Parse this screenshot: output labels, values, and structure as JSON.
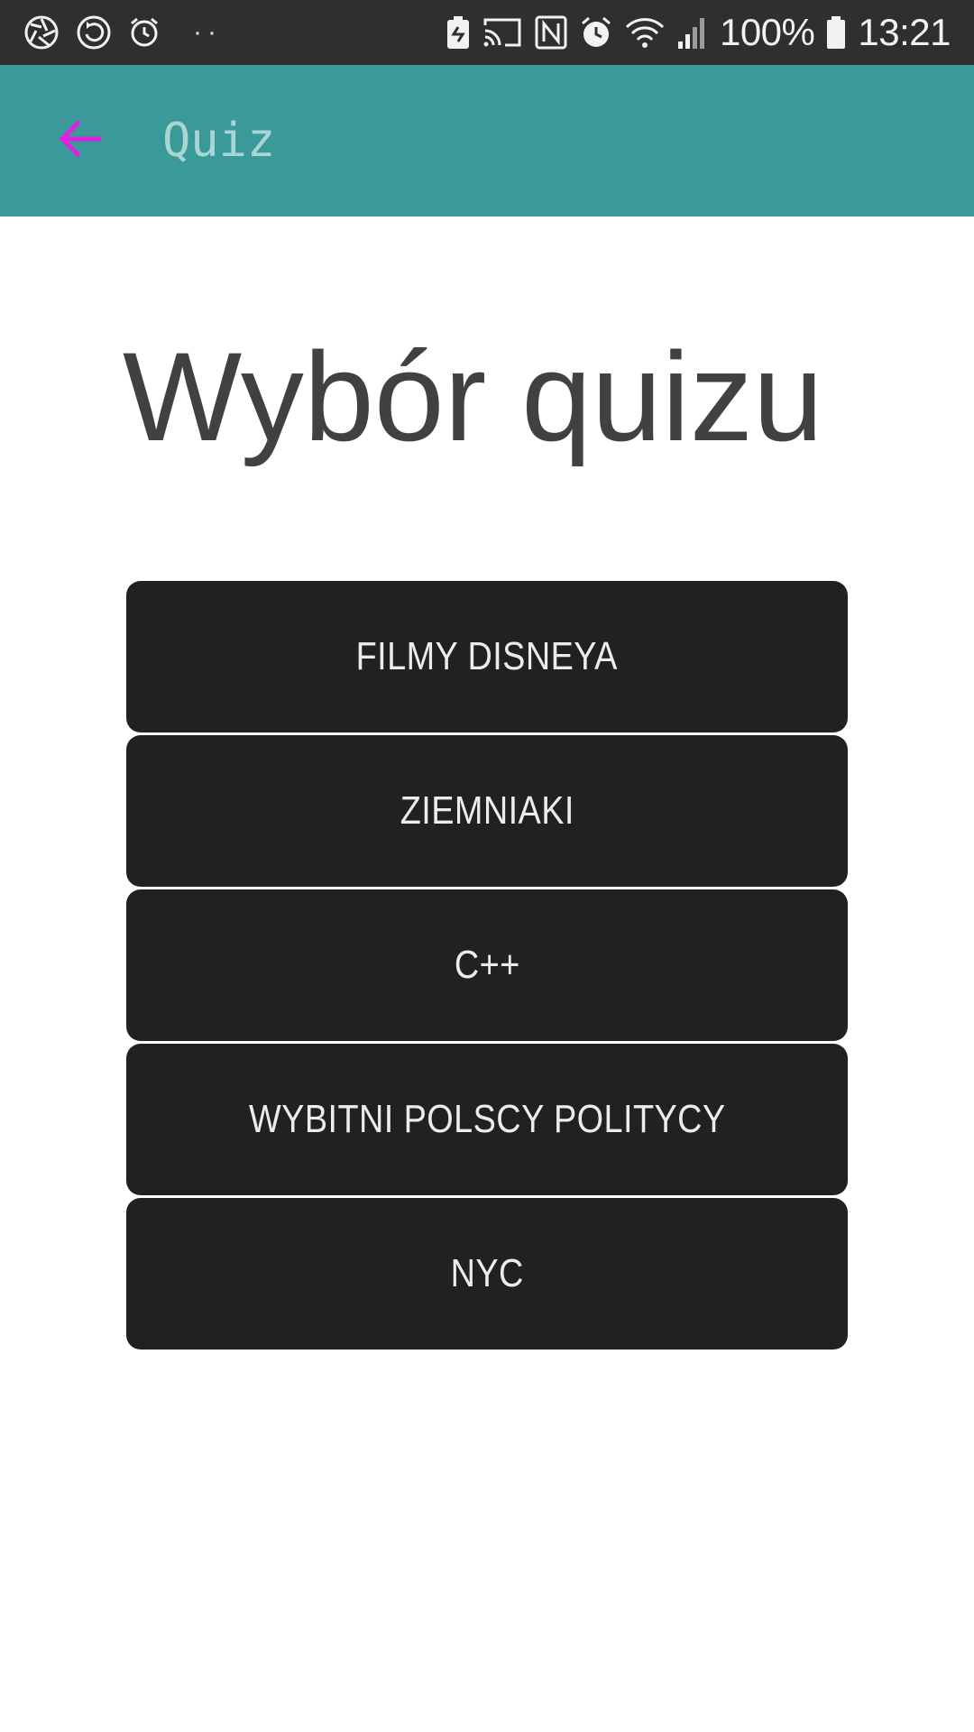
{
  "status_bar": {
    "left_icons": [
      "aperture-icon",
      "sync-icon",
      "alarm-outline-icon"
    ],
    "more_dots": "··",
    "right_icons": [
      "battery-saver-icon",
      "cast-icon",
      "nfc-icon",
      "alarm-icon",
      "wifi-icon",
      "signal-icon"
    ],
    "battery_percent": "100%",
    "time": "13:21"
  },
  "app_bar": {
    "title": "Quiz",
    "back_icon": "back-arrow-icon",
    "background": "#3a9a9a",
    "back_color": "#e020e0"
  },
  "main": {
    "heading": "Wybór quizu",
    "quizzes": [
      {
        "label": "FILMY DISNEYA"
      },
      {
        "label": "ZIEMNIAKI"
      },
      {
        "label": "C++"
      },
      {
        "label": "WYBITNI POLSCY POLITYCY"
      },
      {
        "label": "NYC"
      }
    ]
  }
}
